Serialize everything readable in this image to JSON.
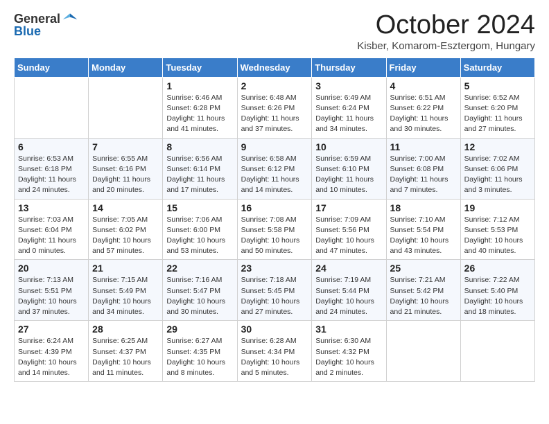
{
  "header": {
    "logo_general": "General",
    "logo_blue": "Blue",
    "month_title": "October 2024",
    "subtitle": "Kisber, Komarom-Esztergom, Hungary"
  },
  "weekdays": [
    "Sunday",
    "Monday",
    "Tuesday",
    "Wednesday",
    "Thursday",
    "Friday",
    "Saturday"
  ],
  "weeks": [
    [
      null,
      null,
      {
        "day": 1,
        "sunrise": "6:46 AM",
        "sunset": "6:28 PM",
        "daylight": "11 hours and 41 minutes."
      },
      {
        "day": 2,
        "sunrise": "6:48 AM",
        "sunset": "6:26 PM",
        "daylight": "11 hours and 37 minutes."
      },
      {
        "day": 3,
        "sunrise": "6:49 AM",
        "sunset": "6:24 PM",
        "daylight": "11 hours and 34 minutes."
      },
      {
        "day": 4,
        "sunrise": "6:51 AM",
        "sunset": "6:22 PM",
        "daylight": "11 hours and 30 minutes."
      },
      {
        "day": 5,
        "sunrise": "6:52 AM",
        "sunset": "6:20 PM",
        "daylight": "11 hours and 27 minutes."
      }
    ],
    [
      {
        "day": 6,
        "sunrise": "6:53 AM",
        "sunset": "6:18 PM",
        "daylight": "11 hours and 24 minutes."
      },
      {
        "day": 7,
        "sunrise": "6:55 AM",
        "sunset": "6:16 PM",
        "daylight": "11 hours and 20 minutes."
      },
      {
        "day": 8,
        "sunrise": "6:56 AM",
        "sunset": "6:14 PM",
        "daylight": "11 hours and 17 minutes."
      },
      {
        "day": 9,
        "sunrise": "6:58 AM",
        "sunset": "6:12 PM",
        "daylight": "11 hours and 14 minutes."
      },
      {
        "day": 10,
        "sunrise": "6:59 AM",
        "sunset": "6:10 PM",
        "daylight": "11 hours and 10 minutes."
      },
      {
        "day": 11,
        "sunrise": "7:00 AM",
        "sunset": "6:08 PM",
        "daylight": "11 hours and 7 minutes."
      },
      {
        "day": 12,
        "sunrise": "7:02 AM",
        "sunset": "6:06 PM",
        "daylight": "11 hours and 3 minutes."
      }
    ],
    [
      {
        "day": 13,
        "sunrise": "7:03 AM",
        "sunset": "6:04 PM",
        "daylight": "11 hours and 0 minutes."
      },
      {
        "day": 14,
        "sunrise": "7:05 AM",
        "sunset": "6:02 PM",
        "daylight": "10 hours and 57 minutes."
      },
      {
        "day": 15,
        "sunrise": "7:06 AM",
        "sunset": "6:00 PM",
        "daylight": "10 hours and 53 minutes."
      },
      {
        "day": 16,
        "sunrise": "7:08 AM",
        "sunset": "5:58 PM",
        "daylight": "10 hours and 50 minutes."
      },
      {
        "day": 17,
        "sunrise": "7:09 AM",
        "sunset": "5:56 PM",
        "daylight": "10 hours and 47 minutes."
      },
      {
        "day": 18,
        "sunrise": "7:10 AM",
        "sunset": "5:54 PM",
        "daylight": "10 hours and 43 minutes."
      },
      {
        "day": 19,
        "sunrise": "7:12 AM",
        "sunset": "5:53 PM",
        "daylight": "10 hours and 40 minutes."
      }
    ],
    [
      {
        "day": 20,
        "sunrise": "7:13 AM",
        "sunset": "5:51 PM",
        "daylight": "10 hours and 37 minutes."
      },
      {
        "day": 21,
        "sunrise": "7:15 AM",
        "sunset": "5:49 PM",
        "daylight": "10 hours and 34 minutes."
      },
      {
        "day": 22,
        "sunrise": "7:16 AM",
        "sunset": "5:47 PM",
        "daylight": "10 hours and 30 minutes."
      },
      {
        "day": 23,
        "sunrise": "7:18 AM",
        "sunset": "5:45 PM",
        "daylight": "10 hours and 27 minutes."
      },
      {
        "day": 24,
        "sunrise": "7:19 AM",
        "sunset": "5:44 PM",
        "daylight": "10 hours and 24 minutes."
      },
      {
        "day": 25,
        "sunrise": "7:21 AM",
        "sunset": "5:42 PM",
        "daylight": "10 hours and 21 minutes."
      },
      {
        "day": 26,
        "sunrise": "7:22 AM",
        "sunset": "5:40 PM",
        "daylight": "10 hours and 18 minutes."
      }
    ],
    [
      {
        "day": 27,
        "sunrise": "6:24 AM",
        "sunset": "4:39 PM",
        "daylight": "10 hours and 14 minutes."
      },
      {
        "day": 28,
        "sunrise": "6:25 AM",
        "sunset": "4:37 PM",
        "daylight": "10 hours and 11 minutes."
      },
      {
        "day": 29,
        "sunrise": "6:27 AM",
        "sunset": "4:35 PM",
        "daylight": "10 hours and 8 minutes."
      },
      {
        "day": 30,
        "sunrise": "6:28 AM",
        "sunset": "4:34 PM",
        "daylight": "10 hours and 5 minutes."
      },
      {
        "day": 31,
        "sunrise": "6:30 AM",
        "sunset": "4:32 PM",
        "daylight": "10 hours and 2 minutes."
      },
      null,
      null
    ]
  ]
}
